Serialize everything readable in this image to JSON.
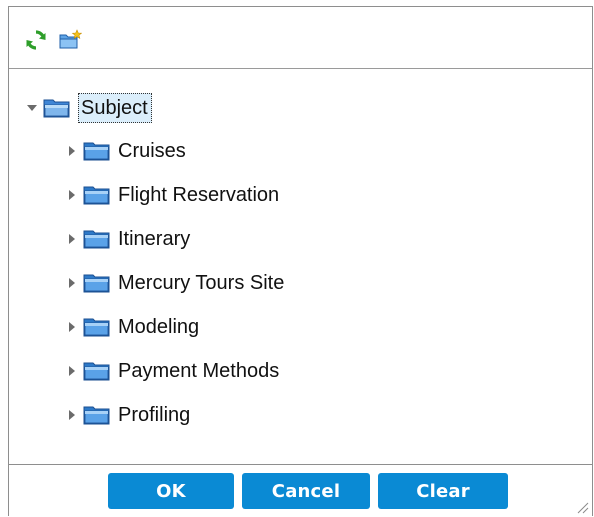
{
  "toolbar": {
    "refresh_icon": "refresh-icon",
    "new_folder_icon": "new-folder-icon"
  },
  "tree": {
    "root": {
      "label": "Subject",
      "expanded": true,
      "selected": true
    },
    "children": [
      {
        "label": "Cruises"
      },
      {
        "label": "Flight Reservation"
      },
      {
        "label": "Itinerary"
      },
      {
        "label": "Mercury Tours Site"
      },
      {
        "label": "Modeling"
      },
      {
        "label": "Payment Methods"
      },
      {
        "label": "Profiling"
      }
    ]
  },
  "buttons": {
    "ok": "OK",
    "cancel": "Cancel",
    "clear": "Clear"
  },
  "colors": {
    "accent": "#0a8ad4",
    "refresh_green": "#2e9e2a",
    "folder_blue": "#2d79c8",
    "selection": "#dbeefb"
  }
}
